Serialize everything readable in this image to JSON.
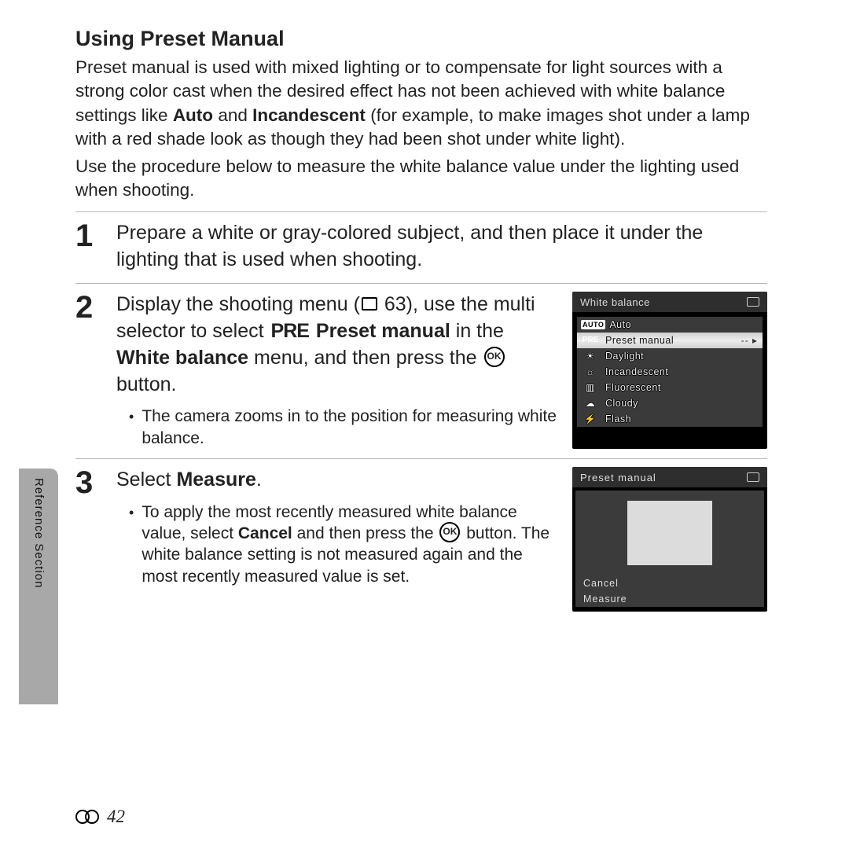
{
  "title": "Using Preset Manual",
  "intro": {
    "p1a": "Preset manual is used with mixed lighting or to compensate for light sources with a strong color cast when the desired effect has not been achieved with white balance settings like ",
    "auto": "Auto",
    "and": " and ",
    "incan": "Incandescent",
    "p1b": " (for example, to make images shot under a lamp with a red shade look as though they had been shot under white light).",
    "p2": "Use the procedure below to measure the white balance value under the lighting used when shooting."
  },
  "steps": {
    "s1": {
      "num": "1",
      "text": "Prepare a white or gray-colored subject, and then place it under the lighting that is used when shooting."
    },
    "s2": {
      "num": "2",
      "line1a": "Display the shooting menu (",
      "line1b": " 63), use the multi selector to select ",
      "preset_manual": "Preset manual",
      "line1c": " in the ",
      "white_balance": "White balance",
      "line1d": " menu, and then press the ",
      "ok": "OK",
      "line1e": " button.",
      "bullet": "The camera zooms in to the position for measuring white balance."
    },
    "s3": {
      "num": "3",
      "head_a": "Select ",
      "head_b": "Measure",
      "head_c": ".",
      "bullet_a": "To apply the most recently measured white balance value, select ",
      "cancel": "Cancel",
      "bullet_b": " and then press the ",
      "ok": "OK",
      "bullet_c": " button. The white balance setting is not measured again and the most recently measured value is set."
    }
  },
  "shot1": {
    "title": "White balance",
    "rows": {
      "auto": "Auto",
      "preset": "Preset manual",
      "daylight": "Daylight",
      "incan": "Incandescent",
      "fluor": "Fluorescent",
      "cloudy": "Cloudy",
      "flash": "Flash"
    },
    "icons": {
      "pre": "PRE"
    }
  },
  "shot2": {
    "title": "Preset manual",
    "cancel": "Cancel",
    "measure": "Measure"
  },
  "sidebar": "Reference Section",
  "pagenum": "42",
  "glyphs": {
    "pre": "PRE",
    "ok": "OK"
  }
}
